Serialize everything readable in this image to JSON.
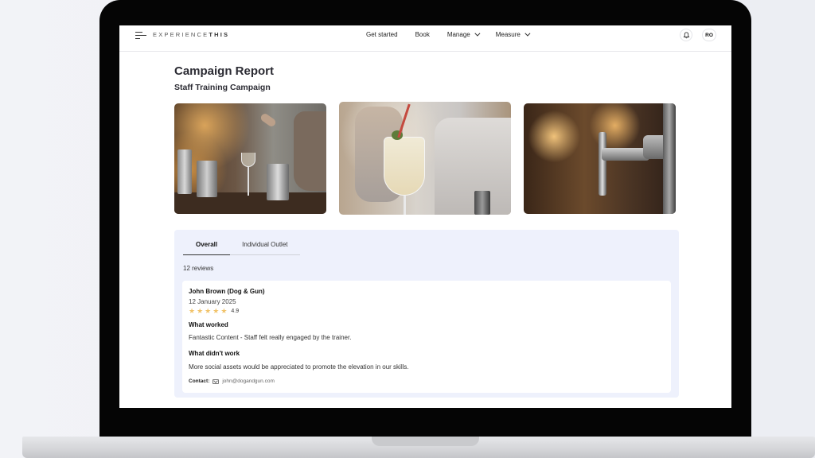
{
  "nav": {
    "brand_light": "EXPERIENCE",
    "brand_bold": "THIS",
    "links": [
      {
        "label": "Get started"
      },
      {
        "label": "Book"
      },
      {
        "label": "Manage"
      },
      {
        "label": "Measure"
      }
    ],
    "avatar_initials": "RO",
    "bell_icon": "bell-icon"
  },
  "page": {
    "title": "Campaign Report",
    "subtitle": "Staff Training Campaign"
  },
  "tabs": [
    {
      "label": "Overall",
      "active": true
    },
    {
      "label": "Individual Outlet",
      "active": false
    }
  ],
  "review_count": "12 reviews",
  "review": {
    "name": "John Brown (Dog & Gun)",
    "date": "12 January 2025",
    "stars": 5,
    "score": "4.9",
    "what_worked_heading": "What worked",
    "what_worked_text": "Fantastic Content - Staff felt really engaged by the trainer.",
    "what_didnt_heading": "What didn't work",
    "what_didnt_text": "More social assets would be appreciated to promote the elevation in our skills.",
    "contact_label": "Contact:",
    "contact_email": "john@dogandgun.com"
  },
  "colors": {
    "panel_bg": "#eef1fc",
    "star": "#f1c36a",
    "title_text": "#2b2b33"
  }
}
